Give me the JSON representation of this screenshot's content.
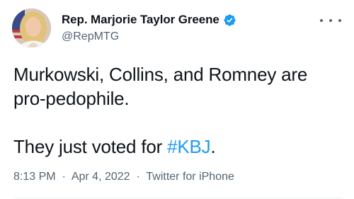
{
  "author": {
    "display_name": "Rep. Marjorie Taylor Greene",
    "handle": "@RepMTG",
    "verified": true
  },
  "tweet": {
    "line1": "Murkowski, Collins, and Romney are",
    "line2": "pro-pedophile.",
    "line3_prefix": "They just voted for ",
    "hashtag": "#KBJ",
    "line3_suffix": "."
  },
  "meta": {
    "time": "8:13 PM",
    "separator": "·",
    "date": "Apr 4, 2022",
    "source": "Twitter for iPhone"
  },
  "colors": {
    "link": "#1d9bf0",
    "secondary_text": "#536471",
    "primary_text": "#0f1419"
  },
  "icons": {
    "avatar": "profile-photo",
    "verified": "verified-badge-icon",
    "more": "more-options-icon"
  }
}
